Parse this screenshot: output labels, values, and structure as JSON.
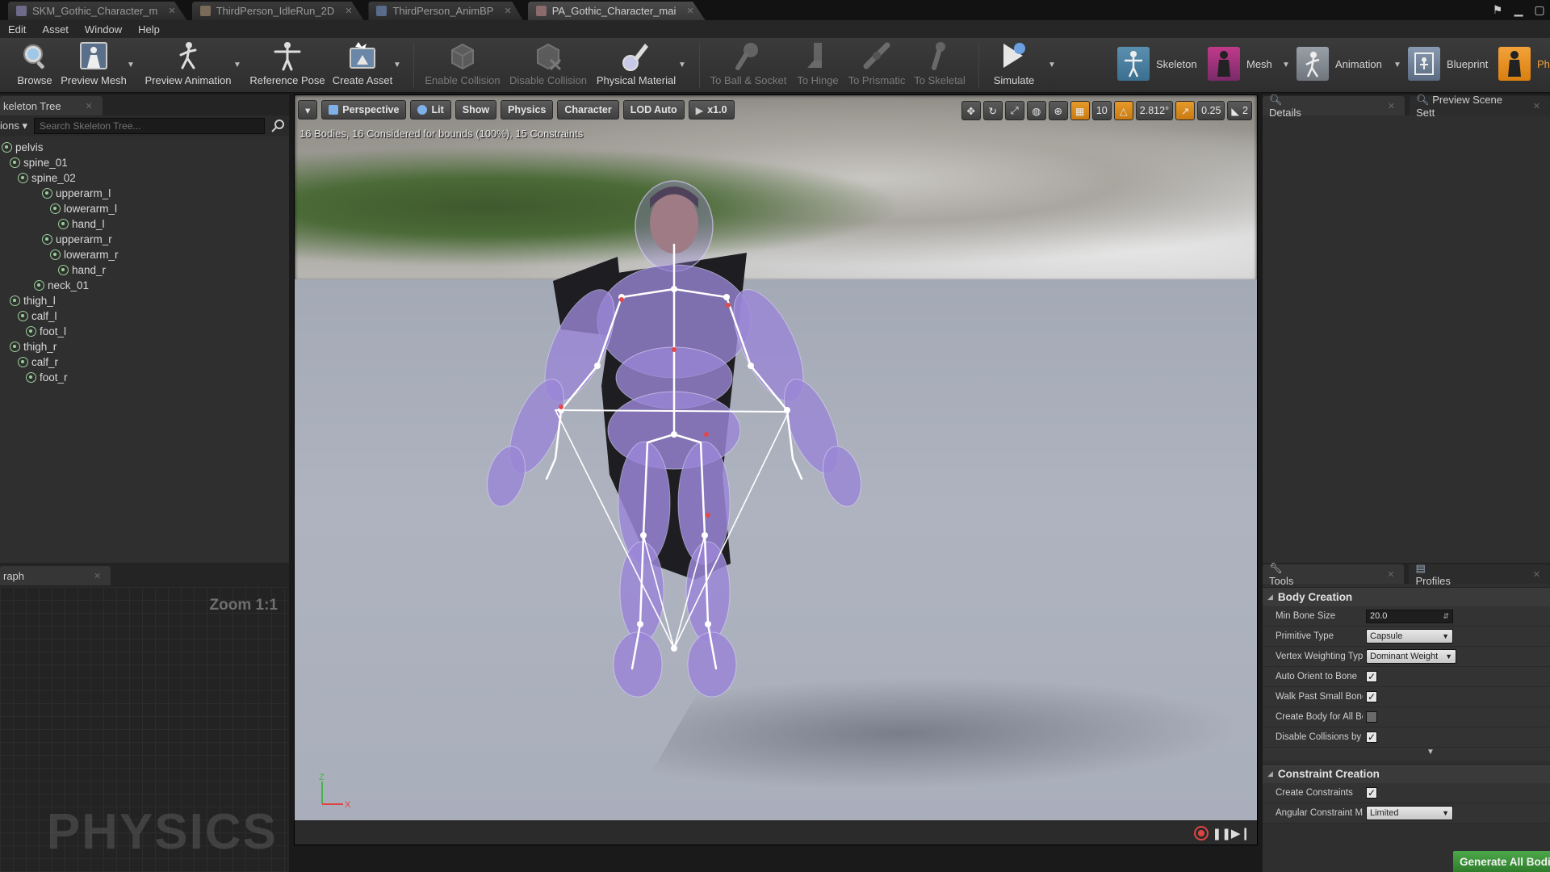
{
  "tabs": [
    {
      "label": "SKM_Gothic_Character_m",
      "active": false
    },
    {
      "label": "ThirdPerson_IdleRun_2D",
      "active": false
    },
    {
      "label": "ThirdPerson_AnimBP",
      "active": false
    },
    {
      "label": "PA_Gothic_Character_mai",
      "active": true
    }
  ],
  "menu": [
    "Edit",
    "Asset",
    "Window",
    "Help"
  ],
  "toolbar": {
    "browse": "Browse",
    "preview_mesh": "Preview Mesh",
    "preview_animation": "Preview Animation",
    "reference_pose": "Reference Pose",
    "create_asset": "Create Asset",
    "enable_collision": "Enable Collision",
    "disable_collision": "Disable Collision",
    "physical_material": "Physical Material",
    "to_ball_socket": "To Ball & Socket",
    "to_hinge": "To Hinge",
    "to_prismatic": "To Prismatic",
    "to_skeletal": "To Skeletal",
    "simulate": "Simulate"
  },
  "modes": {
    "skeleton": "Skeleton",
    "mesh": "Mesh",
    "animation": "Animation",
    "blueprint": "Blueprint",
    "physics_partial": "Ph"
  },
  "skeleton_tree": {
    "tab_label": "keleton Tree",
    "options_label": "ions",
    "search_placeholder": "Search Skeleton Tree...",
    "bones": [
      {
        "name": "pelvis",
        "depth": 0
      },
      {
        "name": "spine_01",
        "depth": 1
      },
      {
        "name": "spine_02",
        "depth": 2
      },
      {
        "name": "upperarm_l",
        "depth": 5
      },
      {
        "name": "lowerarm_l",
        "depth": 6
      },
      {
        "name": "hand_l",
        "depth": 7
      },
      {
        "name": "upperarm_r",
        "depth": 5
      },
      {
        "name": "lowerarm_r",
        "depth": 6
      },
      {
        "name": "hand_r",
        "depth": 7
      },
      {
        "name": "neck_01",
        "depth": 4
      },
      {
        "name": "thigh_l",
        "depth": 1
      },
      {
        "name": "calf_l",
        "depth": 2
      },
      {
        "name": "foot_l",
        "depth": 3
      },
      {
        "name": "thigh_r",
        "depth": 1
      },
      {
        "name": "calf_r",
        "depth": 2
      },
      {
        "name": "foot_r",
        "depth": 3
      }
    ]
  },
  "graph": {
    "tab_label": "raph",
    "zoom": "Zoom 1:1",
    "watermark": "PHYSICS"
  },
  "viewport": {
    "buttons": {
      "perspective": "Perspective",
      "lit": "Lit",
      "show": "Show",
      "physics": "Physics",
      "character": "Character",
      "lod": "LOD Auto",
      "speed": "x1.0"
    },
    "grid_snap": "10",
    "rotation_snap": "2.812°",
    "scale_snap": "0.25",
    "camera_speed": "2",
    "stats": "16 Bodies, 16 Considered for bounds (100%), 15 Constraints"
  },
  "details": {
    "tab_details": "Details",
    "tab_preview": "Preview Scene Sett"
  },
  "tools": {
    "tab_tools": "Tools",
    "tab_profiles": "Profiles",
    "body_creation": {
      "heading": "Body Creation",
      "min_bone_size_label": "Min Bone Size",
      "min_bone_size_value": "20.0",
      "primitive_type_label": "Primitive Type",
      "primitive_type_value": "Capsule",
      "vertex_weighting_label": "Vertex Weighting Type",
      "vertex_weighting_value": "Dominant Weight",
      "auto_orient_label": "Auto Orient to Bone",
      "auto_orient_checked": true,
      "walk_past_label": "Walk Past Small Bones",
      "walk_past_checked": true,
      "create_body_label": "Create Body for All Bones",
      "create_body_checked": false,
      "disable_collisions_label": "Disable Collisions by Default",
      "disable_collisions_checked": true
    },
    "constraint_creation": {
      "heading": "Constraint Creation",
      "create_constraints_label": "Create Constraints",
      "create_constraints_checked": true,
      "angular_mode_label": "Angular Constraint Mode",
      "angular_mode_value": "Limited"
    },
    "generate_button": "Generate All Bodies"
  },
  "colors": {
    "accent_orange": "#f2a23a",
    "generate_green": "#3b9438",
    "physics_body": "#9a86d6"
  }
}
